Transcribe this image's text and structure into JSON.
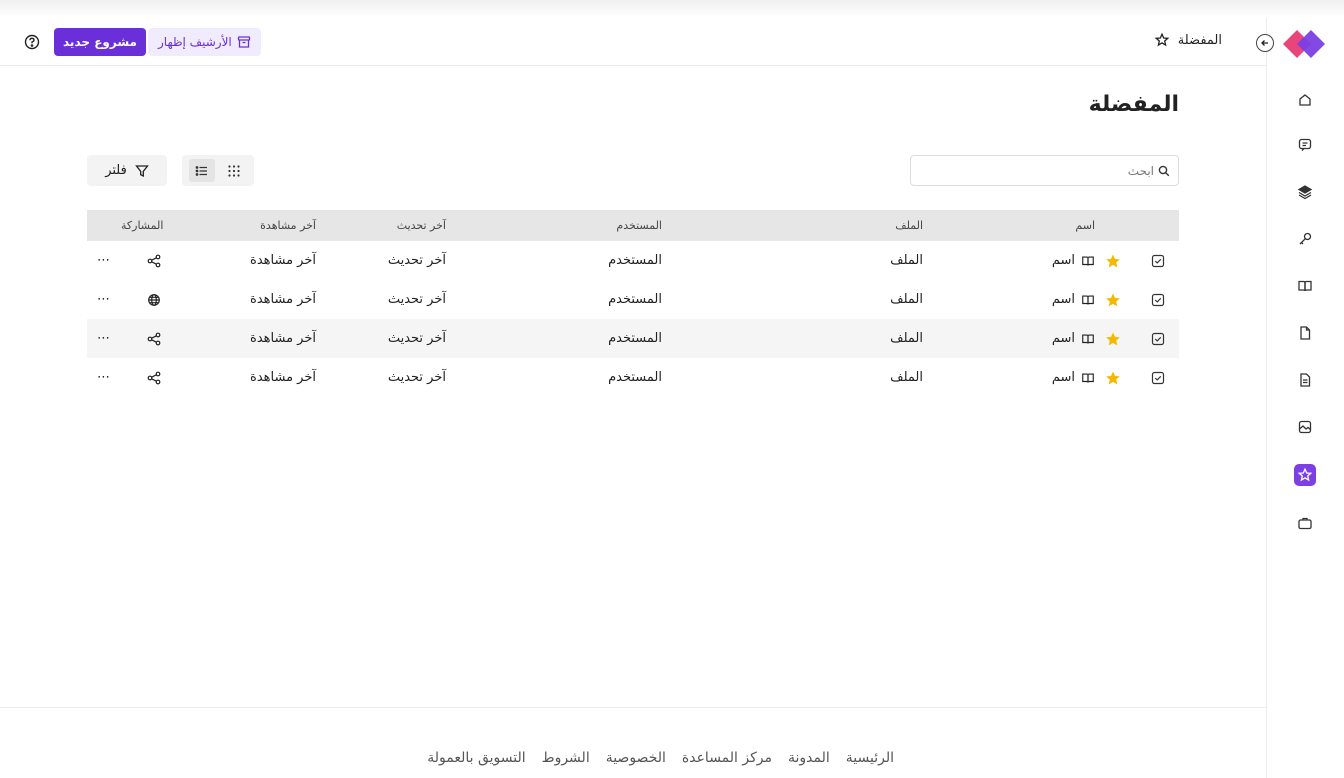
{
  "header": {
    "breadcrumb": "المفضلة",
    "archive_label": "الأرشيف إظهار",
    "new_project_label": "مشروع جديد"
  },
  "page": {
    "title": "المفضلة"
  },
  "search": {
    "placeholder": "ابحث"
  },
  "toolbar": {
    "filter_label": "فلتر",
    "view_mode": "list"
  },
  "table": {
    "headers": {
      "name": "اسم",
      "file": "الملف",
      "user": "المستخدم",
      "updated": "آخر تحديث",
      "seen": "آخر مشاهدة",
      "sharing": "المشاركة"
    },
    "rows": [
      {
        "name": "اسم",
        "file": "الملف",
        "user": "المستخدم",
        "updated": "آخر تحديث",
        "seen": "آخر مشاهدة",
        "share_icon": "share-icon"
      },
      {
        "name": "اسم",
        "file": "الملف",
        "user": "المستخدم",
        "updated": "آخر تحديث",
        "seen": "آخر مشاهدة",
        "share_icon": "globe-icon"
      },
      {
        "name": "اسم",
        "file": "الملف",
        "user": "المستخدم",
        "updated": "آخر تحديث",
        "seen": "آخر مشاهدة",
        "share_icon": "share-icon"
      },
      {
        "name": "اسم",
        "file": "الملف",
        "user": "المستخدم",
        "updated": "آخر تحديث",
        "seen": "آخر مشاهدة",
        "share_icon": "share-icon"
      }
    ],
    "more_label": "⋯"
  },
  "sidebar": {
    "items": [
      {
        "icon": "home-icon"
      },
      {
        "icon": "message-icon"
      },
      {
        "icon": "layers-icon"
      },
      {
        "icon": "key-icon"
      },
      {
        "icon": "book-icon"
      },
      {
        "icon": "file-icon"
      },
      {
        "icon": "document-icon"
      },
      {
        "icon": "image-icon"
      },
      {
        "icon": "star-icon",
        "active": true
      },
      {
        "icon": "briefcase-icon"
      }
    ]
  },
  "footer": {
    "links": [
      "الرئيسية",
      "المدونة",
      "مركز المساعدة",
      "الخصوصية",
      "الشروط",
      "التسويق بالعمولة"
    ]
  },
  "colors": {
    "accent": "#6b2fd9",
    "accent_light": "#f1ecfd",
    "star": "#f5b800",
    "logo_pink": "#e8457a",
    "logo_purple": "#7b3fe4"
  }
}
